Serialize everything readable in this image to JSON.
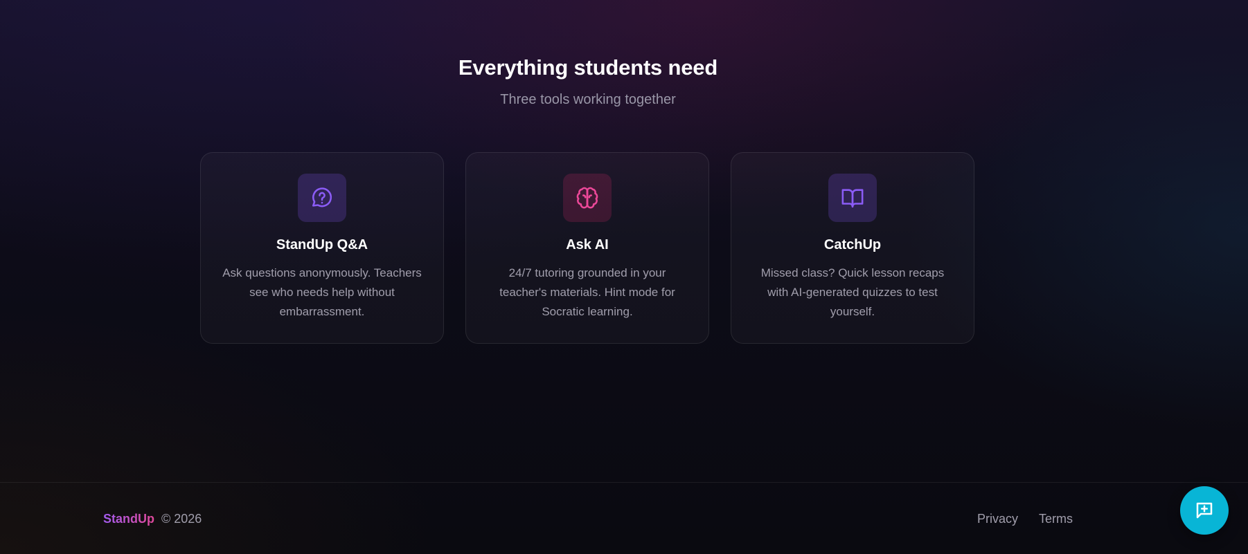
{
  "features": {
    "title": "Everything students need",
    "subtitle": "Three tools working together",
    "cards": [
      {
        "icon": "message-question-icon",
        "title": "StandUp Q&A",
        "description": "Ask questions anonymously. Teachers see who needs help without embarrassment."
      },
      {
        "icon": "brain-icon",
        "title": "Ask AI",
        "description": "24/7 tutoring grounded in your teacher's materials. Hint mode for Socratic learning."
      },
      {
        "icon": "book-open-icon",
        "title": "CatchUp",
        "description": "Missed class? Quick lesson recaps with AI-generated quizzes to test yourself."
      }
    ]
  },
  "footer": {
    "brand": "StandUp",
    "copyright": "© 2026",
    "links": [
      "Privacy",
      "Terms"
    ]
  },
  "fab": {
    "icon": "message-plus-icon"
  },
  "colors": {
    "accent_purple": "#8b5cf6",
    "accent_pink": "#ec4899",
    "fab": "#08b5d6"
  }
}
